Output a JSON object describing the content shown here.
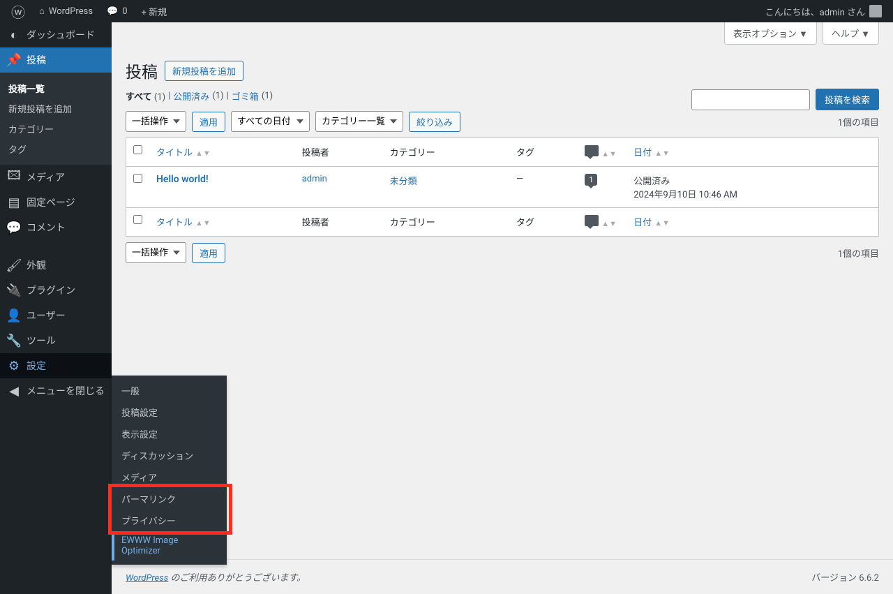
{
  "toolbar": {
    "site_name": "WordPress",
    "comments_count": "0",
    "new_label": "+ 新規",
    "greeting": "こんにちは、admin さん"
  },
  "sidebar": {
    "dashboard": "ダッシュボード",
    "posts": "投稿",
    "posts_sub": {
      "all": "投稿一覧",
      "new": "新規投稿を追加",
      "categories": "カテゴリー",
      "tags": "タグ"
    },
    "media": "メディア",
    "pages": "固定ページ",
    "comments": "コメント",
    "appearance": "外観",
    "plugins": "プラグイン",
    "users": "ユーザー",
    "tools": "ツール",
    "settings": "設定",
    "collapse": "メニューを閉じる"
  },
  "settings_flyout": {
    "general": "一般",
    "writing": "投稿設定",
    "reading": "表示設定",
    "discussion": "ディスカッション",
    "media": "メディア",
    "permalinks": "パーマリンク",
    "privacy": "プライバシー",
    "ewww": "EWWW Image Optimizer"
  },
  "top_options": {
    "screen_options": "表示オプション ▼",
    "help": "ヘルプ ▼"
  },
  "page": {
    "title": "投稿",
    "add_new": "新規投稿を追加"
  },
  "filters": {
    "all": "すべて",
    "all_count": "(1)",
    "published": "公開済み",
    "published_count": "(1)",
    "trash": "ゴミ箱",
    "trash_count": "(1)",
    "separator": " | "
  },
  "search": {
    "button": "投稿を検索"
  },
  "tablenav": {
    "bulk_action": "一括操作",
    "apply": "適用",
    "all_dates": "すべての日付",
    "all_categories": "カテゴリー一覧",
    "filter": "絞り込み",
    "count": "1個の項目"
  },
  "columns": {
    "title": "タイトル",
    "author": "投稿者",
    "categories": "カテゴリー",
    "tags": "タグ",
    "date": "日付"
  },
  "posts": [
    {
      "title": "Hello world!",
      "author": "admin",
      "categories": "未分類",
      "tags": "—",
      "comments": "1",
      "status": "公開済み",
      "date": "2024年9月10日 10:46 AM"
    }
  ],
  "footer": {
    "wp_link": "WordPress",
    "thanks": " のご利用ありがとうございます。",
    "version": "バージョン 6.6.2"
  }
}
